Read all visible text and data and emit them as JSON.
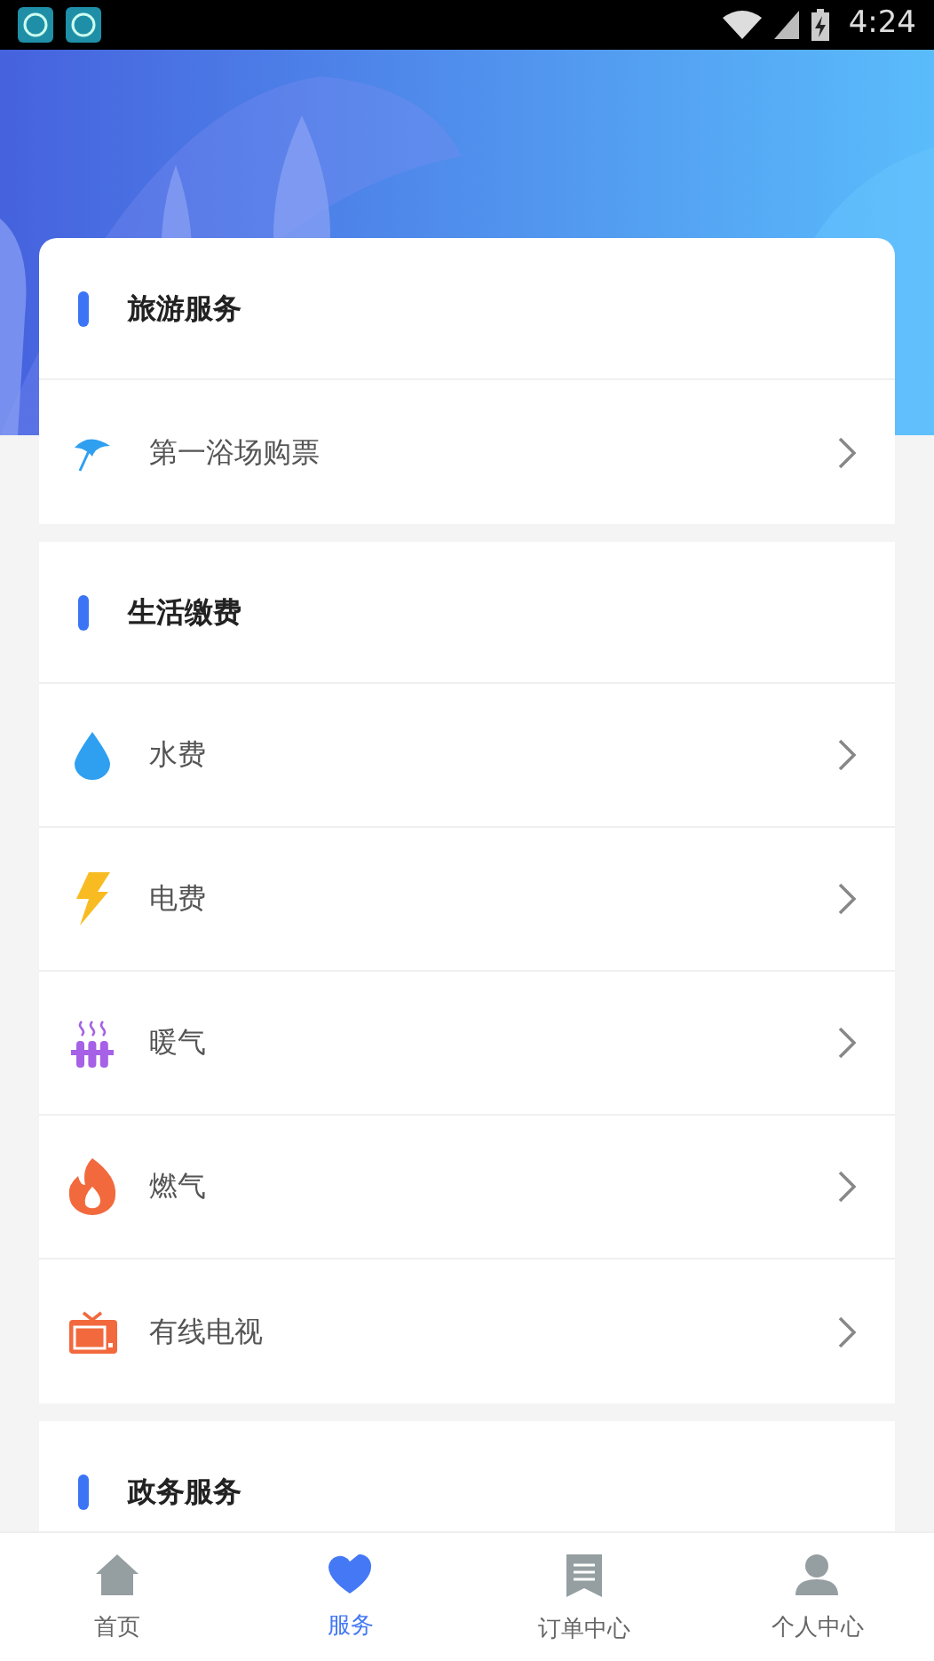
{
  "status_bar": {
    "time": "4:24"
  },
  "sections": [
    {
      "title": "旅游服务",
      "items": [
        {
          "label": "第一浴场购票",
          "kind": "umbrella"
        }
      ]
    },
    {
      "title": "生活缴费",
      "items": [
        {
          "label": "水费",
          "kind": "drop"
        },
        {
          "label": "电费",
          "kind": "bolt"
        },
        {
          "label": "暖气",
          "kind": "radiator"
        },
        {
          "label": "燃气",
          "kind": "flame"
        },
        {
          "label": "有线电视",
          "kind": "tv"
        }
      ]
    },
    {
      "title": "政务服务"
    }
  ],
  "tab_bar": [
    {
      "label": "首页",
      "selected": false
    },
    {
      "label": "服务",
      "selected": true
    },
    {
      "label": "订单中心",
      "selected": false
    },
    {
      "label": "个人中心",
      "selected": false
    }
  ]
}
